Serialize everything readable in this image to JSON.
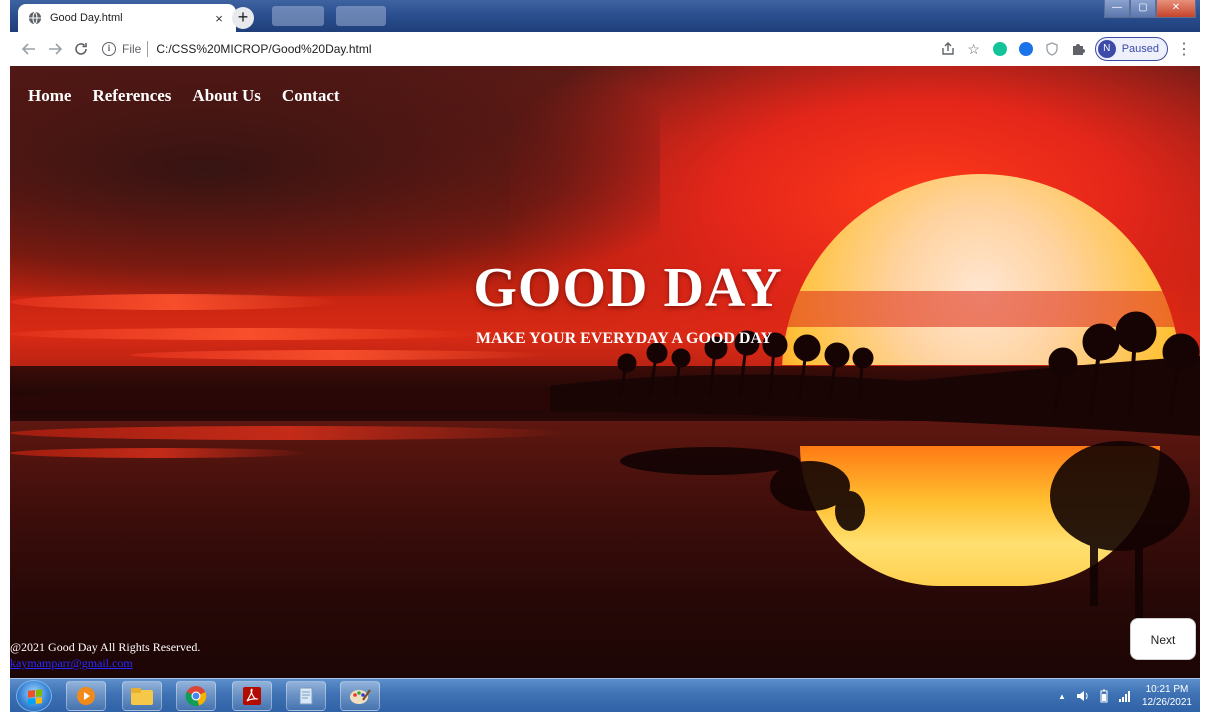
{
  "browser": {
    "tab_title": "Good Day.html",
    "tab_close": "×",
    "new_tab": "+",
    "address_scheme": "File",
    "address_url": "C:/CSS%20MICROP/Good%20Day.html",
    "profile_initial": "N",
    "profile_status": "Paused",
    "window_buttons": [
      "—",
      "▢",
      "✕"
    ]
  },
  "site": {
    "nav": [
      "Home",
      "References",
      "About Us",
      "Contact"
    ],
    "hero_title": "GOOD DAY",
    "hero_subtitle": "MAKE YOUR EVERYDAY A GOOD DAY",
    "footer_copyright": "@2021 Good Day All Rights Reserved.",
    "footer_email": "kaymamparr@gmail.com",
    "next_label": "Next"
  },
  "taskbar": {
    "apps": [
      "windows-media-player-icon",
      "file-explorer-icon",
      "chrome-icon",
      "acrobat-icon",
      "notepad-icon",
      "paint-icon"
    ],
    "time": "10:21 PM",
    "date": "12/26/2021",
    "tray_arrow": "▲"
  },
  "colors": {
    "sky_red": "#d82a14",
    "sun_yellow": "#ffc23a",
    "link_blue": "#2a2aff",
    "taskbar_blue": "#3e72b4"
  }
}
